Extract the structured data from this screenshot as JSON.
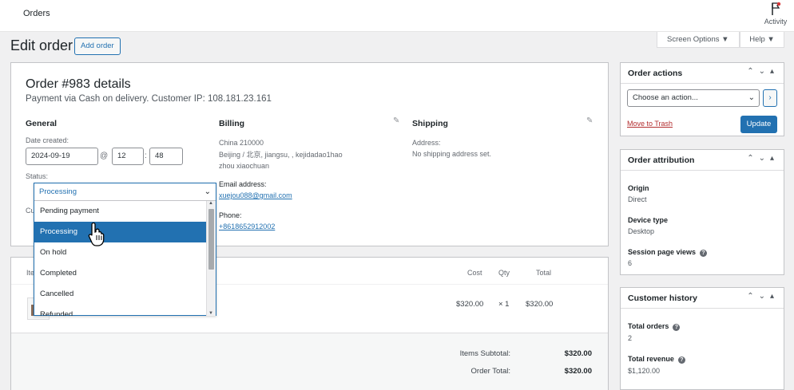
{
  "topbar": {
    "title": "Orders",
    "activity_label": "Activity"
  },
  "tabs": {
    "screen_options": "Screen Options",
    "help": "Help"
  },
  "page": {
    "title": "Edit order",
    "add_order": "Add order"
  },
  "order": {
    "heading": "Order #983 details",
    "subtitle": "Payment via Cash on delivery. Customer IP: 108.181.23.161",
    "general": {
      "heading": "General",
      "date_label": "Date created:",
      "date": "2024-09-19",
      "at": "@",
      "hour": "12",
      "colon": ":",
      "minute": "48",
      "status_label": "Status:",
      "customer_label_partial": "Cu"
    },
    "billing": {
      "heading": "Billing",
      "line1": "China 210000",
      "line2": "Beijing / 北京, jiangsu, , kejidadao1hao",
      "line3": "zhou xiaochuan",
      "email_label": "Email address:",
      "email": "xuejou088@gmail.com",
      "phone_label": "Phone:",
      "phone": "+8618652912002"
    },
    "shipping": {
      "heading": "Shipping",
      "address_label": "Address:",
      "address": "No shipping address set."
    }
  },
  "status_dropdown": {
    "selected": "Processing",
    "options": [
      "Pending payment",
      "Processing",
      "On hold",
      "Completed",
      "Cancelled",
      "Refunded"
    ],
    "highlighted_index": 1
  },
  "items": {
    "col_item_partial": "Ite",
    "col_cost": "Cost",
    "col_qty": "Qty",
    "col_total": "Total",
    "rows": [
      {
        "cost": "$320.00",
        "qty": "× 1",
        "total": "$320.00"
      }
    ],
    "subtotal_label": "Items Subtotal:",
    "subtotal": "$320.00",
    "order_total_label": "Order Total:",
    "order_total": "$320.00"
  },
  "order_actions": {
    "title": "Order actions",
    "select": "Choose an action...",
    "go": "›",
    "trash": "Move to Trash",
    "update": "Update"
  },
  "attribution": {
    "title": "Order attribution",
    "origin_label": "Origin",
    "origin": "Direct",
    "device_label": "Device type",
    "device": "Desktop",
    "views_label": "Session page views",
    "views": "6"
  },
  "history": {
    "title": "Customer history",
    "orders_label": "Total orders",
    "orders": "2",
    "revenue_label": "Total revenue",
    "revenue": "$1,120.00"
  },
  "colors": {
    "accent": "#2271b1",
    "danger": "#b32d2e"
  }
}
